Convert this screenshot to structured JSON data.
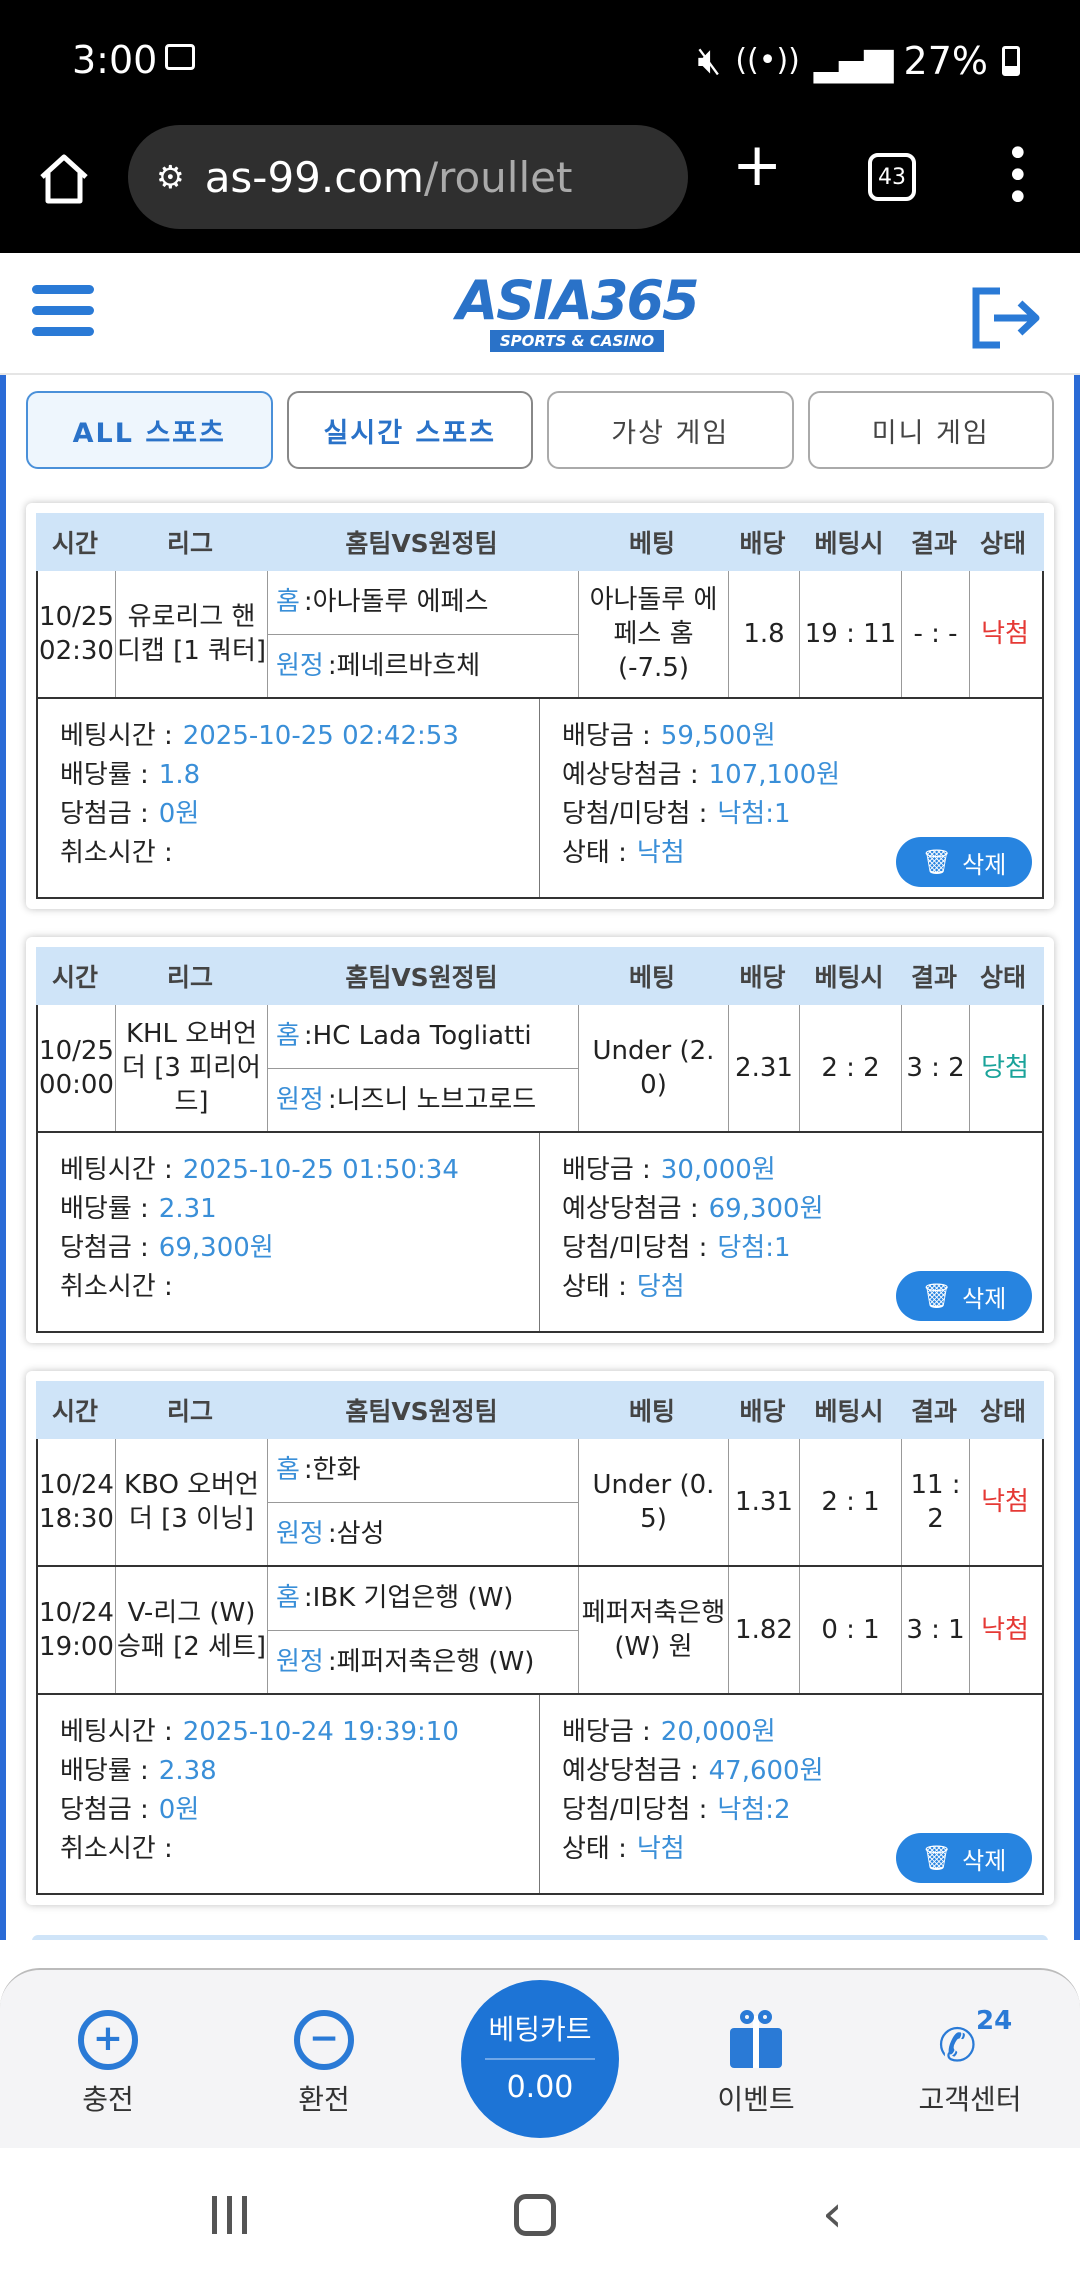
{
  "status_bar": {
    "time": "3:00",
    "battery": "27%"
  },
  "browser": {
    "url_host": "as-99.com",
    "url_path": "/roullet",
    "tab_count": "43"
  },
  "brand": {
    "logo_text": "ASIA365",
    "logo_sub": "SPORTS & CASINO",
    "accent": "#2a72c8"
  },
  "tabs": [
    {
      "label": "ALL 스포츠"
    },
    {
      "label": "실시간 스포츠"
    },
    {
      "label": "가상 게임"
    },
    {
      "label": "미니 게임"
    }
  ],
  "table_headers": [
    "시간",
    "리그",
    "홈팀VS원정팀",
    "베팅",
    "배당",
    "베팅시",
    "결과",
    "상태"
  ],
  "prefixes": {
    "home": "홈",
    "away": "원정"
  },
  "summary_labels": {
    "bet_time": "베팅시간 :",
    "odds": "배당률 :",
    "win_amount": "당첨금 :",
    "cancel_time": "취소시간 :",
    "stake": "배당금 :",
    "expected": "예상당첨금 :",
    "win_lose": "당첨/미당첨 :",
    "status": "상태 :",
    "delete": "삭제"
  },
  "bets": [
    {
      "rows": [
        {
          "time": "10/25 02:30",
          "league": "유로리그 핸디캡 [1 쿼터]",
          "home": ":아나돌루 에페스",
          "away": ":페네르바흐체",
          "pick": "아나돌루 에페스 홈 (-7.5)",
          "odds": "1.8",
          "score_at_bet": "19 : 11",
          "result": "- : -",
          "status": "낙첨"
        }
      ],
      "summary": {
        "bet_time": "2025-10-25 02:42:53",
        "odds": "1.8",
        "win_amount": "0원",
        "cancel_time": "",
        "stake": "59,500원",
        "expected": "107,100원",
        "win_lose": "낙첨:1",
        "status": "낙첨"
      }
    },
    {
      "rows": [
        {
          "time": "10/25 00:00",
          "league": "KHL 오버언더 [3 피리어드]",
          "home": ":HC Lada Togliatti",
          "away": ":니즈니 노브고로드",
          "pick": "Under (2. 0)",
          "odds": "2.31",
          "score_at_bet": "2 : 2",
          "result": "3 : 2",
          "status": "당첨"
        }
      ],
      "summary": {
        "bet_time": "2025-10-25 01:50:34",
        "odds": "2.31",
        "win_amount": "69,300원",
        "cancel_time": "",
        "stake": "30,000원",
        "expected": "69,300원",
        "win_lose": "당첨:1",
        "status": "당첨"
      }
    },
    {
      "rows": [
        {
          "time": "10/24 18:30",
          "league": "KBO 오버언더 [3 이닝]",
          "home": ":한화",
          "away": ":삼성",
          "pick": "Under (0. 5)",
          "odds": "1.31",
          "score_at_bet": "2 : 1",
          "result": "11 : 2",
          "status": "낙첨"
        },
        {
          "time": "10/24 19:00",
          "league": "V-리그 (W) 승패 [2 세트]",
          "home": ":IBK 기업은행 (W)",
          "away": ":페퍼저축은행 (W)",
          "pick": "페퍼저축은행 (W) 원",
          "odds": "1.82",
          "score_at_bet": "0 : 1",
          "result": "3 : 1",
          "status": "낙첨"
        }
      ],
      "summary": {
        "bet_time": "2025-10-24 19:39:10",
        "odds": "2.38",
        "win_amount": "0원",
        "cancel_time": "",
        "stake": "20,000원",
        "expected": "47,600원",
        "win_lose": "낙첨:2",
        "status": "낙첨"
      }
    }
  ],
  "bottom_nav": {
    "charge": "충전",
    "exchange": "환전",
    "cart_label": "베팅카트",
    "cart_value": "0.00",
    "event": "이벤트",
    "support": "고객센터",
    "support_badge": "24"
  },
  "colors": {
    "lose": "#e53935",
    "win": "#1aa39a",
    "link": "#3a8fd8",
    "nav_blue": "#1d74d6"
  }
}
